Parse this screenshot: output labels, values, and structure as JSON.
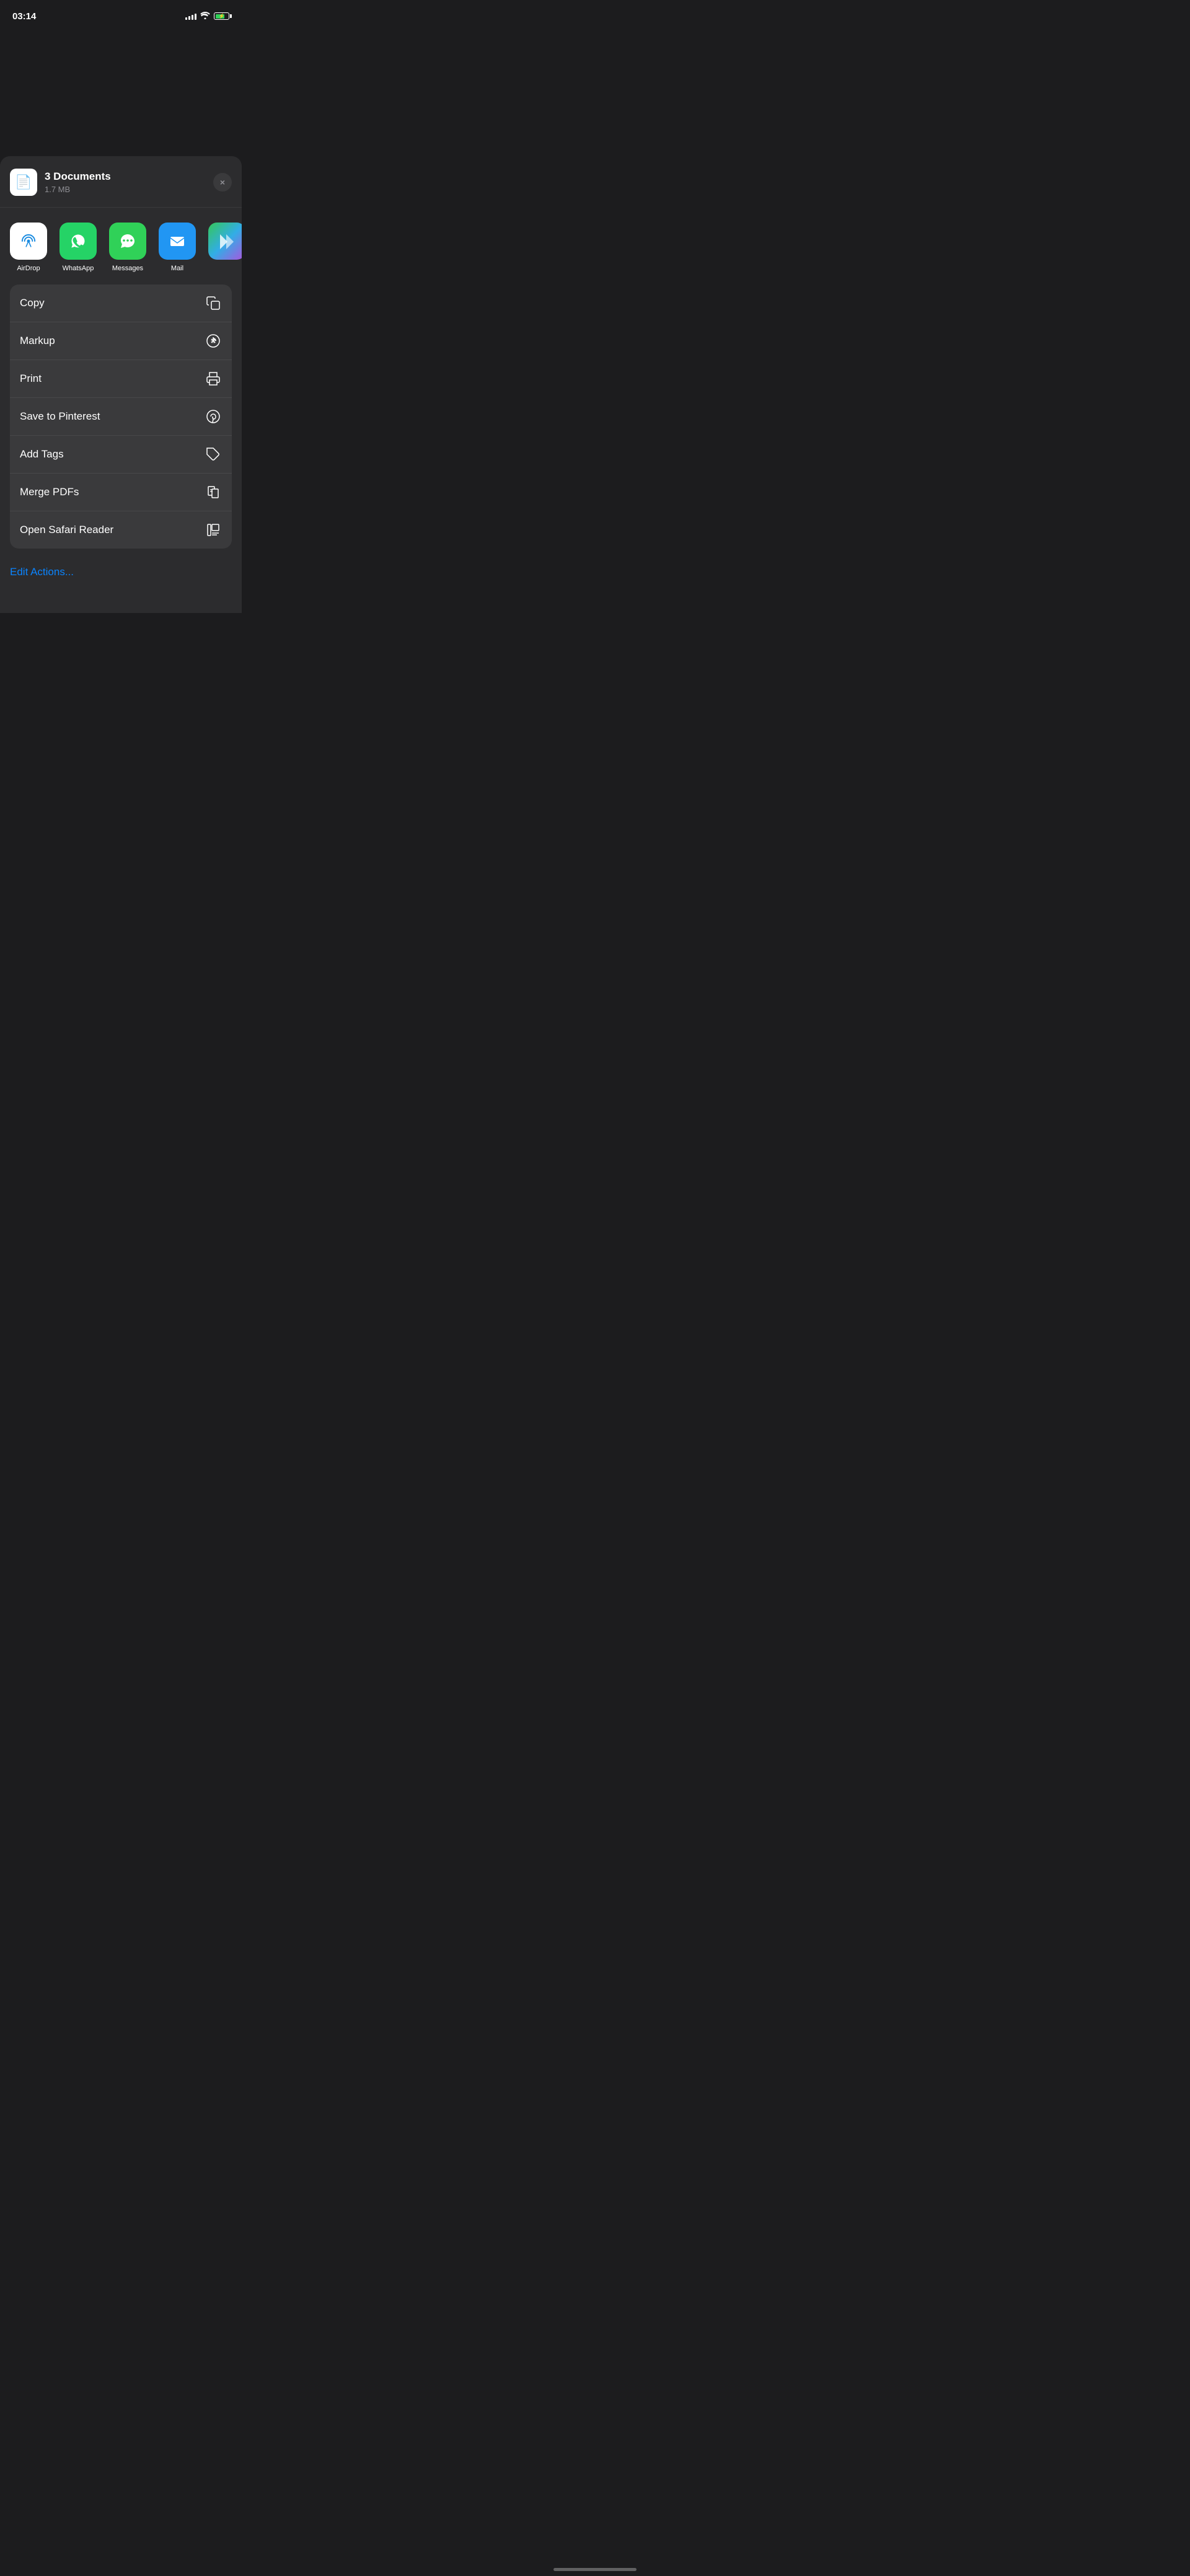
{
  "statusBar": {
    "time": "03:14",
    "battery_level": 70
  },
  "shareHeader": {
    "title": "3 Documents",
    "size": "1.7 MB",
    "close_label": "×"
  },
  "apps": [
    {
      "id": "airdrop",
      "label": "AirDrop",
      "type": "airdrop"
    },
    {
      "id": "whatsapp",
      "label": "WhatsApp",
      "type": "whatsapp"
    },
    {
      "id": "messages",
      "label": "Messages",
      "type": "messages"
    },
    {
      "id": "mail",
      "label": "Mail",
      "type": "mail"
    },
    {
      "id": "more",
      "label": "",
      "type": "more"
    }
  ],
  "actions": [
    {
      "id": "copy",
      "label": "Copy",
      "icon": "copy"
    },
    {
      "id": "markup",
      "label": "Markup",
      "icon": "markup"
    },
    {
      "id": "print",
      "label": "Print",
      "icon": "print"
    },
    {
      "id": "save-pinterest",
      "label": "Save to Pinterest",
      "icon": "pinterest"
    },
    {
      "id": "add-tags",
      "label": "Add Tags",
      "icon": "tag"
    },
    {
      "id": "merge-pdfs",
      "label": "Merge PDFs",
      "icon": "merge"
    },
    {
      "id": "open-safari",
      "label": "Open Safari Reader",
      "icon": "safari-reader"
    }
  ],
  "editActions": {
    "label": "Edit Actions..."
  }
}
